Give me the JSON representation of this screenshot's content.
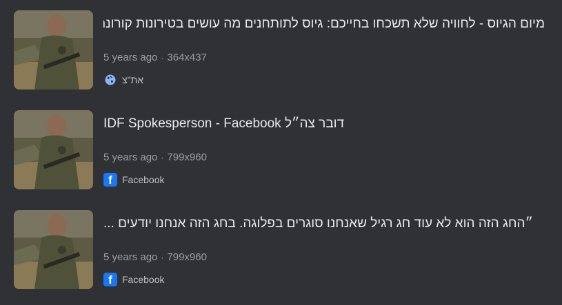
{
  "results": [
    {
      "title": "מיום הגיוס - לחוויה שלא תשכחו בחייכם: גיוס לתותחנים מה עושים בטירונות קורונה",
      "age": "5 years ago",
      "dimensions": "364x437",
      "source": "את\"צ",
      "source_icon": "globe-icon"
    },
    {
      "title": "דובר צה״ל IDF Spokesperson - Facebook",
      "age": "5 years ago",
      "dimensions": "799x960",
      "source": "Facebook",
      "source_icon": "facebook-icon"
    },
    {
      "title": "״החג הזה הוא לא עוד חג רגיל שאנחנו סוגרים בפלוגה. בחג הזה אנחנו יודעים ...",
      "age": "5 years ago",
      "dimensions": "799x960",
      "source": "Facebook",
      "source_icon": "facebook-icon"
    }
  ],
  "separator": "·",
  "facebook_glyph": "f",
  "colors": {
    "background": "#303134",
    "title": "#e8eaed",
    "meta": "#9aa0a6",
    "facebook": "#1877f2"
  }
}
